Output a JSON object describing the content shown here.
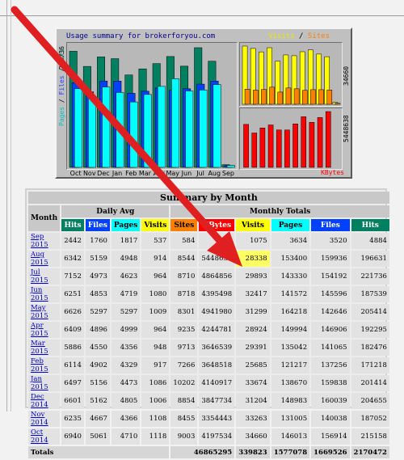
{
  "graph": {
    "title": "Usage summary for brokerforyou.com",
    "legend_right_visits": "Visits",
    "legend_right_sep": " / ",
    "legend_right_sites": "Sites",
    "legend_left_pages": "Pages",
    "legend_left_sep1": " / ",
    "legend_left_files": "Files",
    "legend_left_sep2": " / ",
    "legend_left_hits": "Hits",
    "y_left_max": "221736",
    "y_right_top_max": "34660",
    "y_right_bottom_max": "5448638",
    "kbytes_label": "KBytes",
    "months": [
      "Oct",
      "Nov",
      "Dec",
      "Jan",
      "Feb",
      "Mar",
      "Apr",
      "May",
      "Jun",
      "Jul",
      "Aug",
      "Sep"
    ],
    "colors": {
      "hits": "#008060",
      "files": "#0040ff",
      "pages": "#00ffff",
      "visits": "#ffff00",
      "sites": "#ff8000",
      "kbytes": "#ff0000"
    }
  },
  "chart_data": {
    "type": "bar",
    "title": "Usage summary for brokerforyou.com",
    "categories": [
      "Oct",
      "Nov",
      "Dec",
      "Jan",
      "Feb",
      "Mar",
      "Apr",
      "May",
      "Jun",
      "Jul",
      "Aug",
      "Sep"
    ],
    "series": [
      {
        "name": "Hits",
        "values": [
          215158,
          187052,
          204655,
          201414,
          171218,
          182476,
          192295,
          205414,
          187539,
          221736,
          196631,
          4884
        ]
      },
      {
        "name": "Files",
        "values": [
          156914,
          140038,
          160039,
          159838,
          137256,
          141065,
          146906,
          142646,
          145596,
          154192,
          159936,
          3520
        ]
      },
      {
        "name": "Pages",
        "values": [
          146013,
          131005,
          148983,
          138670,
          121217,
          135042,
          149994,
          164218,
          141572,
          143330,
          153400,
          3634
        ]
      },
      {
        "name": "Visits",
        "values": [
          34660,
          33263,
          31204,
          33674,
          25685,
          29391,
          28924,
          31299,
          32417,
          29893,
          28338,
          1075
        ]
      },
      {
        "name": "Sites",
        "values": [
          9003,
          8455,
          8854,
          10202,
          7266,
          9713,
          9235,
          8301,
          8718,
          8710,
          8544,
          584
        ]
      },
      {
        "name": "KBytes",
        "values": [
          4197534,
          3354443,
          3847734,
          4140917,
          3648518,
          3646539,
          4244781,
          4941980,
          4395498,
          4864856,
          5448638,
          0
        ]
      }
    ]
  },
  "summary": {
    "title": "Summary by Month",
    "month_header": "Month",
    "daily_avg_header": "Daily Avg",
    "monthly_totals_header": "Monthly Totals",
    "col_hits": "Hits",
    "col_files": "Files",
    "col_pages": "Pages",
    "col_visits": "Visits",
    "col_sites": "Sites",
    "col_kbytes": "KBytes",
    "rows": [
      {
        "month": "Sep 2015",
        "d_hits": "2442",
        "d_files": "1760",
        "d_pages": "1817",
        "d_visits": "537",
        "sites": "584",
        "kbytes": "",
        "visits": "1075",
        "pages": "3634",
        "files": "3520",
        "hits": "4884"
      },
      {
        "month": "Aug 2015",
        "d_hits": "6342",
        "d_files": "5159",
        "d_pages": "4948",
        "d_visits": "914",
        "sites": "8544",
        "kbytes": "5448638",
        "visits": "28338",
        "pages": "153400",
        "files": "159936",
        "hits": "196631"
      },
      {
        "month": "Jul 2015",
        "d_hits": "7152",
        "d_files": "4973",
        "d_pages": "4623",
        "d_visits": "964",
        "sites": "8710",
        "kbytes": "4864856",
        "visits": "29893",
        "pages": "143330",
        "files": "154192",
        "hits": "221736"
      },
      {
        "month": "Jun 2015",
        "d_hits": "6251",
        "d_files": "4853",
        "d_pages": "4719",
        "d_visits": "1080",
        "sites": "8718",
        "kbytes": "4395498",
        "visits": "32417",
        "pages": "141572",
        "files": "145596",
        "hits": "187539"
      },
      {
        "month": "May 2015",
        "d_hits": "6626",
        "d_files": "5297",
        "d_pages": "5297",
        "d_visits": "1009",
        "sites": "8301",
        "kbytes": "4941980",
        "visits": "31299",
        "pages": "164218",
        "files": "142646",
        "hits": "205414"
      },
      {
        "month": "Apr 2015",
        "d_hits": "6409",
        "d_files": "4896",
        "d_pages": "4999",
        "d_visits": "964",
        "sites": "9235",
        "kbytes": "4244781",
        "visits": "28924",
        "pages": "149994",
        "files": "146906",
        "hits": "192295"
      },
      {
        "month": "Mar 2015",
        "d_hits": "5886",
        "d_files": "4550",
        "d_pages": "4356",
        "d_visits": "948",
        "sites": "9713",
        "kbytes": "3646539",
        "visits": "29391",
        "pages": "135042",
        "files": "141065",
        "hits": "182476"
      },
      {
        "month": "Feb 2015",
        "d_hits": "6114",
        "d_files": "4902",
        "d_pages": "4329",
        "d_visits": "917",
        "sites": "7266",
        "kbytes": "3648518",
        "visits": "25685",
        "pages": "121217",
        "files": "137256",
        "hits": "171218"
      },
      {
        "month": "Jan 2015",
        "d_hits": "6497",
        "d_files": "5156",
        "d_pages": "4473",
        "d_visits": "1086",
        "sites": "10202",
        "kbytes": "4140917",
        "visits": "33674",
        "pages": "138670",
        "files": "159838",
        "hits": "201414"
      },
      {
        "month": "Dec 2014",
        "d_hits": "6601",
        "d_files": "5162",
        "d_pages": "4805",
        "d_visits": "1006",
        "sites": "8854",
        "kbytes": "3847734",
        "visits": "31204",
        "pages": "148983",
        "files": "160039",
        "hits": "204655"
      },
      {
        "month": "Nov 2014",
        "d_hits": "6235",
        "d_files": "4667",
        "d_pages": "4366",
        "d_visits": "1108",
        "sites": "8455",
        "kbytes": "3354443",
        "visits": "33263",
        "pages": "131005",
        "files": "140038",
        "hits": "187052"
      },
      {
        "month": "Oct 2014",
        "d_hits": "6940",
        "d_files": "5061",
        "d_pages": "4710",
        "d_visits": "1118",
        "sites": "9003",
        "kbytes": "4197534",
        "visits": "34660",
        "pages": "146013",
        "files": "156914",
        "hits": "215158"
      }
    ],
    "totals": {
      "label": "Totals",
      "kbytes": "46865295",
      "visits": "339823",
      "pages": "1577078",
      "files": "1669526",
      "hits": "2170472"
    }
  },
  "annotation": {
    "arrow_color": "#e02020",
    "highlight_color": "#ffff66"
  }
}
